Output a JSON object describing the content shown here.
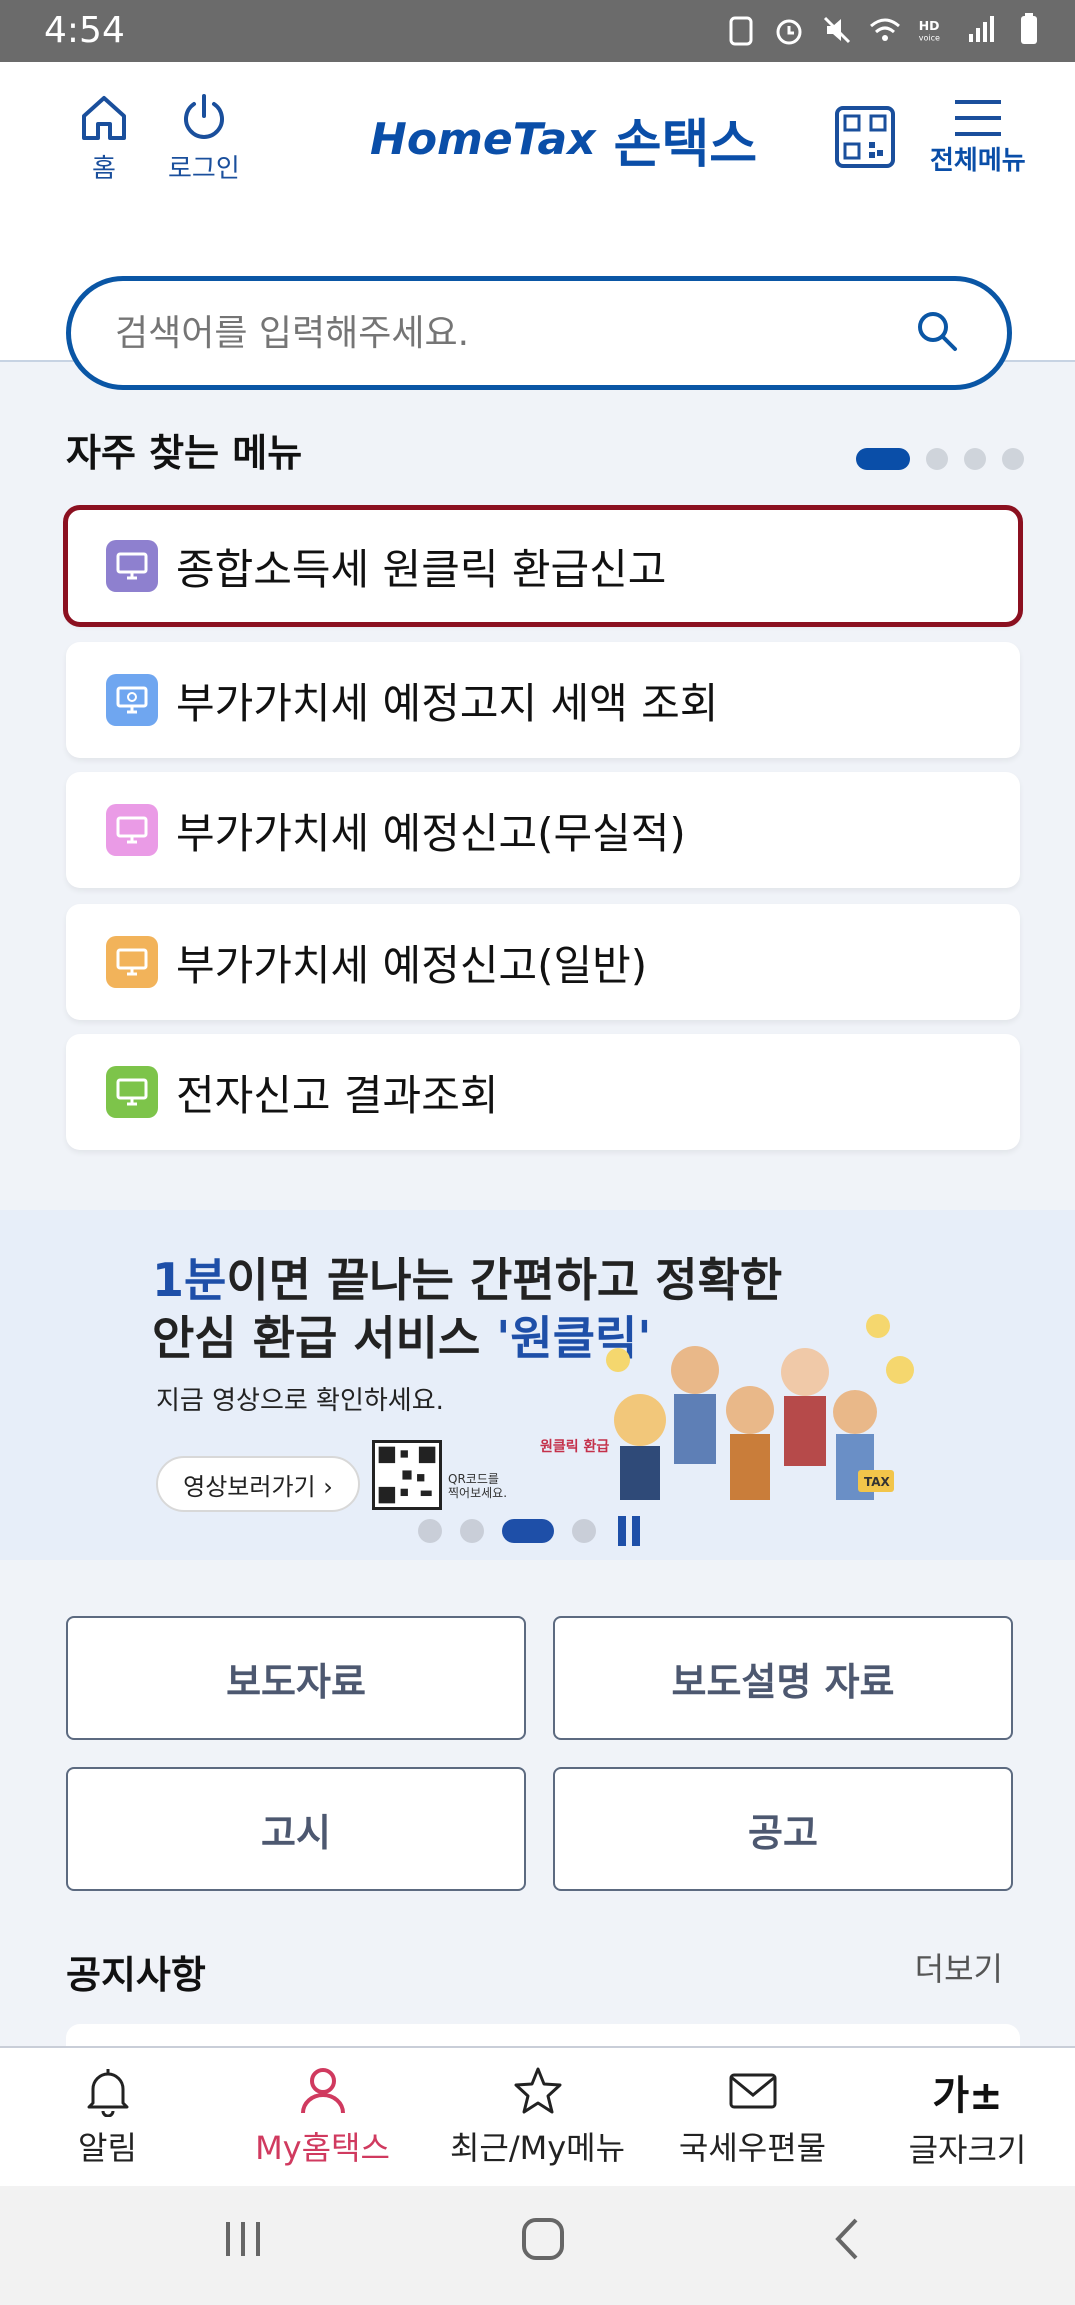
{
  "status": {
    "time": "4:54"
  },
  "header": {
    "home_label": "홈",
    "login_label": "로그인",
    "logo_brand": "HomeTax",
    "logo_korean": "손택스",
    "menu_label": "전체메뉴"
  },
  "search": {
    "placeholder": "검색어를 입력해주세요."
  },
  "frequent": {
    "title": "자주 찾는 메뉴",
    "items": [
      {
        "label": "종합소득세 원클릭 환급신고",
        "color": "#8e80cf"
      },
      {
        "label": "부가가치세 예정고지 세액 조회",
        "color": "#6fa6f0"
      },
      {
        "label": "부가가치세 예정신고(무실적)",
        "color": "#ea9be6"
      },
      {
        "label": "부가가치세 예정신고(일반)",
        "color": "#f2b35a"
      },
      {
        "label": "전자신고 결과조회",
        "color": "#7dc44a"
      }
    ]
  },
  "banner": {
    "line1_highlight": "1분",
    "line1_rest": "이면 끝나는 간편하고 정확한",
    "line2_rest": "안심 환급 서비스 ",
    "line2_highlight": "'원클릭'",
    "line3": "지금 영상으로 확인하세요.",
    "video_button": "영상보러가기 ›",
    "qr_text_1": "QR코드를",
    "qr_text_2": "찍어보세요.",
    "badge": "원클릭 환급"
  },
  "buttons": {
    "press": "보도자료",
    "press_explain": "보도설명 자료",
    "notice_gosi": "고시",
    "notice_gonggo": "공고"
  },
  "notices": {
    "title": "공지사항",
    "more": "더보기"
  },
  "bottom_nav": {
    "alarm": "알림",
    "my_hometax": "My홈택스",
    "recent": "최근/My메뉴",
    "mail": "국세우편물",
    "font_size_icon": "가±",
    "font_size": "글자크기"
  }
}
